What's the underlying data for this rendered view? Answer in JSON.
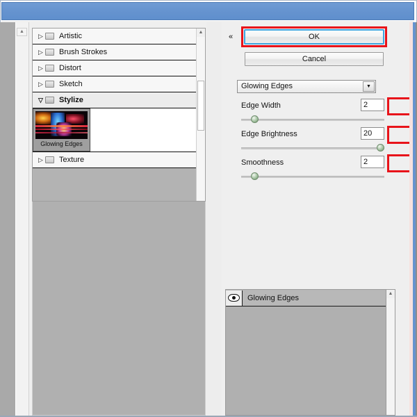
{
  "window": {
    "title": ""
  },
  "filter_tree": {
    "categories": [
      {
        "label": "Artistic",
        "expanded": false,
        "icon": "triangle-right-icon",
        "folder": "folder-icon"
      },
      {
        "label": "Brush Strokes",
        "expanded": false,
        "icon": "triangle-right-icon",
        "folder": "folder-icon"
      },
      {
        "label": "Distort",
        "expanded": false,
        "icon": "triangle-right-icon",
        "folder": "folder-icon"
      },
      {
        "label": "Sketch",
        "expanded": false,
        "icon": "triangle-right-icon",
        "folder": "folder-icon"
      },
      {
        "label": "Stylize",
        "expanded": true,
        "icon": "triangle-down-icon",
        "folder": "folder-open-icon"
      },
      {
        "label": "Texture",
        "expanded": false,
        "icon": "triangle-right-icon",
        "folder": "folder-icon"
      }
    ],
    "expanded_thumbnails": [
      {
        "label": "Glowing Edges",
        "selected": true
      }
    ],
    "triangle_right": "▷",
    "triangle_down": "▽",
    "scroll_up_glyph": "▲",
    "scroll_down_glyph": "▼"
  },
  "settings": {
    "collapse_glyph": "«",
    "ok_label": "OK",
    "cancel_label": "Cancel",
    "filter_select": {
      "value": "Glowing Edges",
      "arrow_glyph": "▼"
    },
    "sliders": [
      {
        "label": "Edge Width",
        "value": "2",
        "knob_percent": 9
      },
      {
        "label": "Edge Brightness",
        "value": "20",
        "knob_percent": 97
      },
      {
        "label": "Smoothness",
        "value": "2",
        "knob_percent": 9
      }
    ]
  },
  "layer_panel": {
    "rows": [
      {
        "name": "Glowing Edges",
        "visible": true,
        "icon": "eye-icon"
      }
    ]
  },
  "annotations": {
    "highlight_color": "#e8131a",
    "focus_color": "#3ea6e0",
    "boxes": [
      "ok-button",
      "edge-width-value",
      "edge-brightness-value",
      "smoothness-value"
    ]
  }
}
